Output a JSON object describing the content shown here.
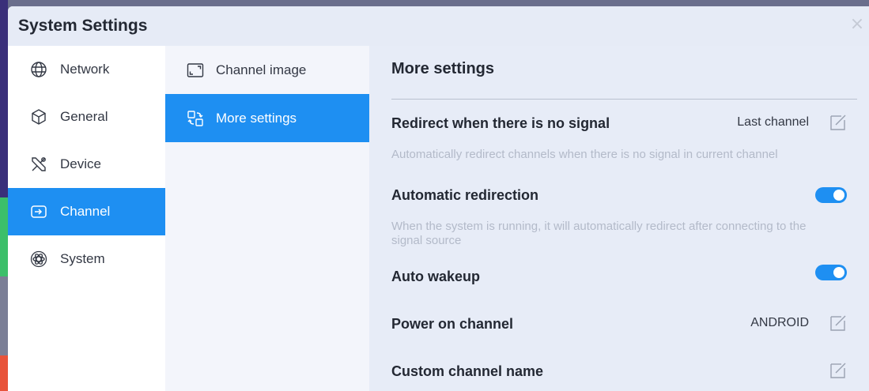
{
  "window": {
    "title": "System Settings"
  },
  "sidebar": {
    "items": [
      {
        "label": "Network",
        "icon": "globe-icon",
        "active": false
      },
      {
        "label": "General",
        "icon": "cube-icon",
        "active": false
      },
      {
        "label": "Device",
        "icon": "tools-icon",
        "active": false
      },
      {
        "label": "Channel",
        "icon": "input-icon",
        "active": true
      },
      {
        "label": "System",
        "icon": "atom-icon",
        "active": false
      }
    ]
  },
  "submenu": {
    "items": [
      {
        "label": "Channel image",
        "icon": "screen-icon",
        "active": false
      },
      {
        "label": "More settings",
        "icon": "switch-icon",
        "active": true
      }
    ]
  },
  "panel": {
    "title": "More settings",
    "redirect": {
      "label": "Redirect when there is no signal",
      "value": "Last channel",
      "description": "Automatically redirect channels when there is no signal in current channel"
    },
    "auto_redirection": {
      "label": "Automatic redirection",
      "enabled": true,
      "description": "When the system is running, it will automatically redirect after connecting to the signal source"
    },
    "auto_wakeup": {
      "label": "Auto wakeup",
      "enabled": true
    },
    "power_on_channel": {
      "label": "Power on channel",
      "value": "ANDROID"
    },
    "custom_channel_name": {
      "label": "Custom channel name"
    }
  },
  "colors": {
    "accent": "#1e8ff2",
    "titlebar_bg": "#e6ebf6",
    "panel_bg": "#e7ecf7",
    "muted_text": "#b3bac9"
  }
}
